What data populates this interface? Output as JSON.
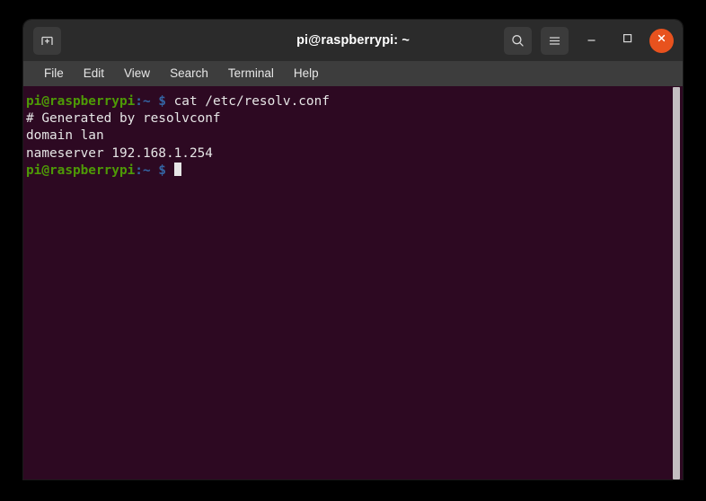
{
  "window": {
    "title": "pi@raspberrypi: ~",
    "titlebar": {
      "new_tab_label": "New Tab",
      "search_label": "Search",
      "menu_label": "Menu",
      "minimize_label": "Minimize",
      "maximize_label": "Maximize",
      "close_label": "Close"
    },
    "menubar": {
      "items": [
        {
          "label": "File"
        },
        {
          "label": "Edit"
        },
        {
          "label": "View"
        },
        {
          "label": "Search"
        },
        {
          "label": "Terminal"
        },
        {
          "label": "Help"
        }
      ]
    }
  },
  "terminal": {
    "prompt": {
      "user_host": "pi@raspberrypi",
      "path": ":~",
      "sigil": "$"
    },
    "lines": [
      {
        "type": "prompt",
        "user_host": "pi@raspberrypi",
        "path": ":~",
        "sigil": "$",
        "command": " cat /etc/resolv.conf"
      },
      {
        "type": "output",
        "text": "# Generated by resolvconf"
      },
      {
        "type": "output",
        "text": "domain lan"
      },
      {
        "type": "output",
        "text": "nameserver 192.168.1.254"
      },
      {
        "type": "prompt",
        "user_host": "pi@raspberrypi",
        "path": ":~",
        "sigil": "$",
        "command": " ",
        "cursor": true
      }
    ]
  },
  "colors": {
    "titlebar_bg": "#2b2b2b",
    "menubar_bg": "#3d3d3d",
    "terminal_bg": "#2d0922",
    "close_button": "#e8521e",
    "prompt_green": "#4e9a06",
    "prompt_blue": "#3465a4",
    "text_white": "#e6e6e6",
    "scrollbar_thumb": "#c3bec1",
    "desktop_bg": "#000000"
  },
  "scrollbar": {
    "position": "right",
    "thumb_label": "Scrollbar thumb"
  }
}
